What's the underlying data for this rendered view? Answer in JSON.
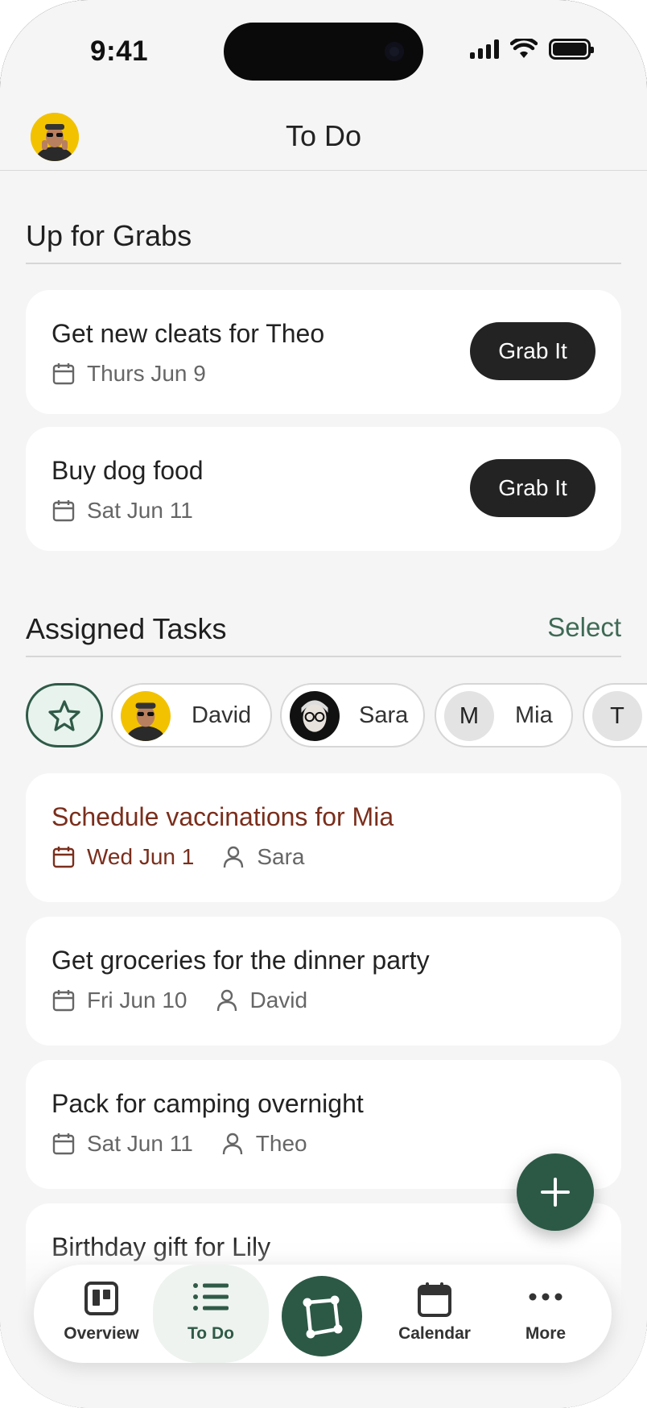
{
  "status": {
    "time": "9:41"
  },
  "header": {
    "title": "To Do"
  },
  "grabs": {
    "heading": "Up for Grabs",
    "button_label": "Grab It",
    "items": [
      {
        "title": "Get new cleats for Theo",
        "date": "Thurs Jun 9"
      },
      {
        "title": "Buy dog food",
        "date": "Sat Jun 11"
      }
    ]
  },
  "assigned": {
    "heading": "Assigned Tasks",
    "select_label": "Select",
    "filters": [
      {
        "name": "David",
        "avatar": "photo"
      },
      {
        "name": "Sara",
        "avatar": "photo"
      },
      {
        "name": "Mia",
        "avatar_letter": "M"
      },
      {
        "name": "",
        "avatar_letter": "T"
      }
    ],
    "tasks": [
      {
        "title": "Schedule vaccinations for Mia",
        "date": "Wed Jun 1",
        "assignee": "Sara",
        "overdue": true
      },
      {
        "title": "Get groceries for the dinner party",
        "date": "Fri Jun 10",
        "assignee": "David"
      },
      {
        "title": "Pack for camping overnight",
        "date": "Sat Jun 11",
        "assignee": "Theo"
      },
      {
        "title": "Birthday gift for Lily"
      }
    ]
  },
  "nav": {
    "items": [
      {
        "label": "Overview",
        "icon": "board-icon"
      },
      {
        "label": "To Do",
        "icon": "list-icon",
        "active": true
      },
      {
        "label": "",
        "icon": "polygon-icon"
      },
      {
        "label": "Calendar",
        "icon": "calendar-icon"
      },
      {
        "label": "More",
        "icon": "more-icon"
      }
    ]
  },
  "colors": {
    "accent": "#2c5946",
    "overdue": "#7a2e1c",
    "grab_button": "#232323",
    "background": "#f5f5f5"
  }
}
